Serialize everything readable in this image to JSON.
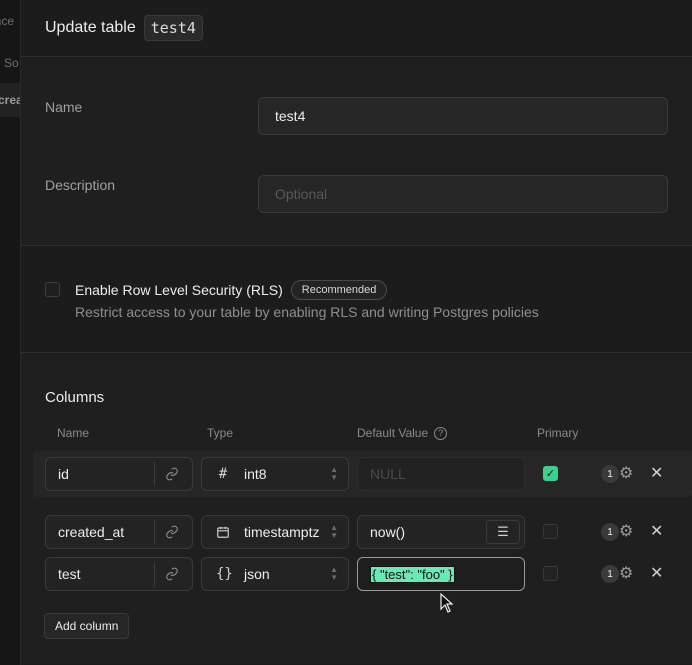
{
  "underlay": {
    "items": [
      "ance",
      "So",
      "crea"
    ]
  },
  "header": {
    "title": "Update table",
    "table_name": "test4"
  },
  "general": {
    "name_label": "Name",
    "name_value": "test4",
    "description_label": "Description",
    "description_placeholder": "Optional"
  },
  "rls": {
    "title": "Enable Row Level Security (RLS)",
    "badge": "Recommended",
    "description": "Restrict access to your table by enabling RLS and writing Postgres policies",
    "checked": false
  },
  "columns": {
    "title": "Columns",
    "headers": {
      "name": "Name",
      "type": "Type",
      "default": "Default Value",
      "primary": "Primary"
    },
    "rows": [
      {
        "name": "id",
        "type_icon": "#",
        "type": "int8",
        "default": "",
        "default_placeholder": "NULL",
        "primary": true,
        "count": "1"
      },
      {
        "name": "created_at",
        "type_icon": "calendar-icon",
        "type": "timestamptz",
        "default": "now()",
        "primary": false,
        "count": "1"
      },
      {
        "name": "test",
        "type_icon": "{}",
        "type": "json",
        "default": "{ \"test\": \"foo\" }",
        "primary": false,
        "count": "1"
      }
    ],
    "add_button": "Add column"
  },
  "colors": {
    "accent": "#3ecf8e",
    "highlight": "#6ee7b7",
    "background": "#1c1c1c"
  }
}
